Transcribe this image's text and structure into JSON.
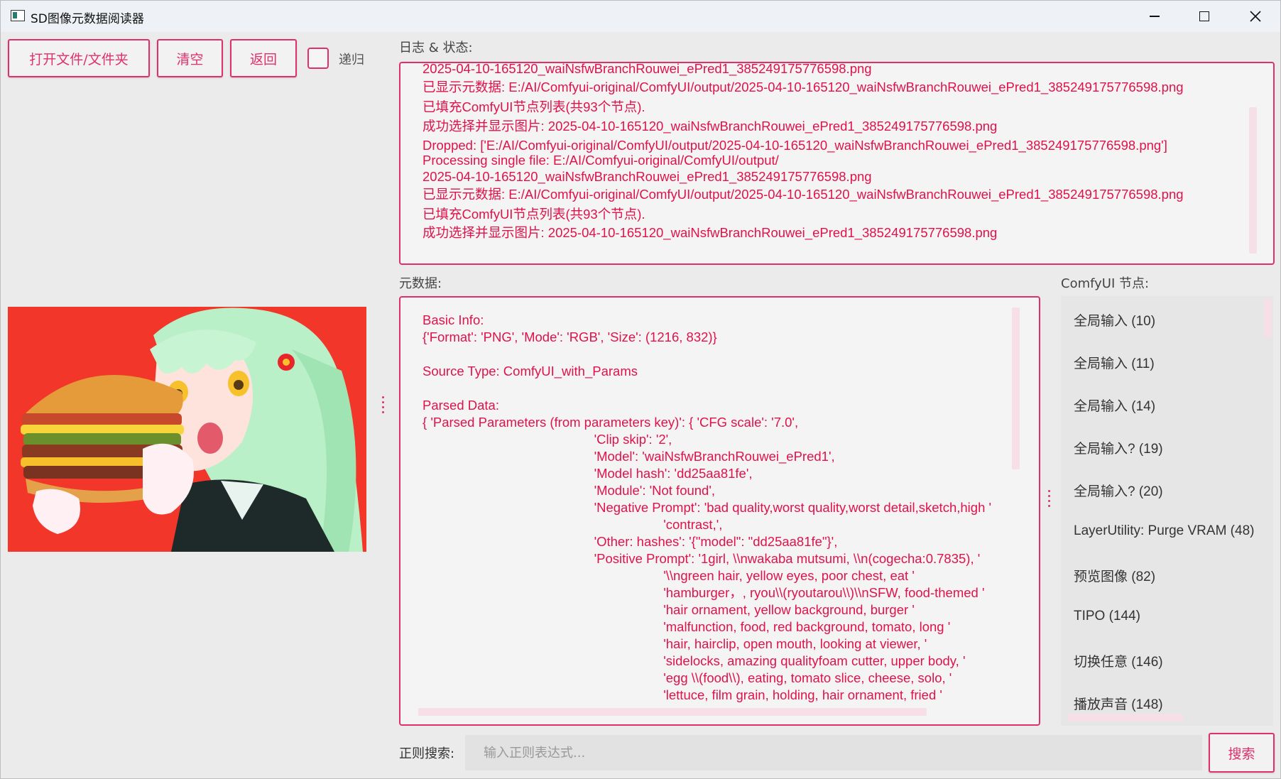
{
  "window": {
    "title": "SD图像元数据阅读器",
    "controls": {
      "minimize": "minimize-icon",
      "maximize": "maximize-icon",
      "close": "close-icon"
    }
  },
  "toolbar": {
    "open_label": "打开文件/文件夹",
    "clear_label": "清空",
    "back_label": "返回",
    "recursive_label": "递归",
    "recursive_checked": false
  },
  "image": {
    "description_icon": "burger-girl-preview"
  },
  "log": {
    "label": "日志 & 状态:",
    "lines": [
      "2025-04-10-165120_waiNsfwBranchRouwei_ePred1_385249175776598.png",
      "已显示元数据: E:/AI/Comfyui-original/ComfyUI/output/2025-04-10-165120_waiNsfwBranchRouwei_ePred1_385249175776598.png",
      "已填充ComfyUI节点列表(共93个节点).",
      "成功选择并显示图片: 2025-04-10-165120_waiNsfwBranchRouwei_ePred1_385249175776598.png",
      "Dropped: ['E:/AI/Comfyui-original/ComfyUI/output/2025-04-10-165120_waiNsfwBranchRouwei_ePred1_385249175776598.png']",
      "Processing single file: E:/AI/Comfyui-original/ComfyUI/output/",
      "2025-04-10-165120_waiNsfwBranchRouwei_ePred1_385249175776598.png",
      "已显示元数据: E:/AI/Comfyui-original/ComfyUI/output/2025-04-10-165120_waiNsfwBranchRouwei_ePred1_385249175776598.png",
      "已填充ComfyUI节点列表(共93个节点).",
      "成功选择并显示图片: 2025-04-10-165120_waiNsfwBranchRouwei_ePred1_385249175776598.png"
    ]
  },
  "metadata": {
    "label": "元数据:",
    "text": "Basic Info:\n{'Format': 'PNG', 'Mode': 'RGB', 'Size': (1216, 832)}\n\nSource Type: ComfyUI_with_Params\n\nParsed Data:\n{ 'Parsed Parameters (from parameters key)': { 'CFG scale': '7.0',\n                                               'Clip skip': '2',\n                                               'Model': 'waiNsfwBranchRouwei_ePred1',\n                                               'Model hash': 'dd25aa81fe',\n                                               'Module': 'Not found',\n                                               'Negative Prompt': 'bad quality,worst quality,worst detail,sketch,high '\n                                                                  'contrast,',\n                                               'Other: hashes': '{\"model\": \"dd25aa81fe\"}',\n                                               'Positive Prompt': '1girl, \\\\nwakaba mutsumi, \\\\n(cogecha:0.7835), '\n                                                                  '\\\\ngreen hair, yellow eyes, poor chest, eat '\n                                                                  'hamburger，, ryou\\\\(ryoutarou\\\\)\\\\nSFW, food-themed '\n                                                                  'hair ornament, yellow background, burger '\n                                                                  'malfunction, food, red background, tomato, long '\n                                                                  'hair, hairclip, open mouth, looking at viewer, '\n                                                                  'sidelocks, amazing qualityfoam cutter, upper body, '\n                                                                  'egg \\\\(food\\\\), eating, tomato slice, cheese, solo, '\n                                                                  'lettuce, film grain, holding, hair ornament, fried '"
  },
  "nodes": {
    "label": "ComfyUI 节点:",
    "items": [
      "全局输入 (10)",
      "全局输入 (11)",
      "全局输入 (14)",
      "全局输入? (19)",
      "全局输入? (20)",
      "LayerUtility: Purge VRAM (48)",
      "预览图像 (82)",
      "TIPO (144)",
      "切换任意 (146)",
      "播放声音 (148)"
    ]
  },
  "search": {
    "label": "正则搜索:",
    "placeholder": "输入正则表达式...",
    "value": "",
    "button_label": "搜索"
  },
  "colors": {
    "accent": "#e0306a",
    "log_text": "#e0124a",
    "image_bg": "#f3362a"
  }
}
